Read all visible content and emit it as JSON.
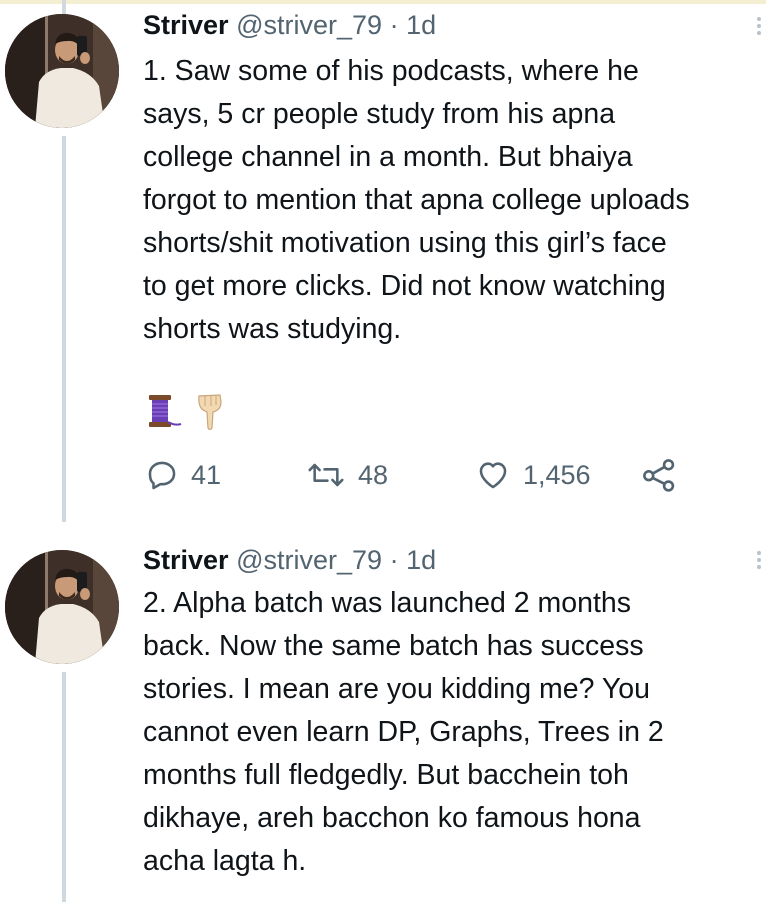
{
  "tweets": [
    {
      "author": "Striver",
      "handle": "@striver_79",
      "separator": "·",
      "time": "1d",
      "lines": [
        "1. Saw some of his podcasts, where he",
        "says, 5 cr people study from his apna",
        "college channel in a month. But bhaiya",
        "forgot to mention that apna college uploads",
        "shorts/shit motivation using this girl’s face",
        "to get more clicks. Did not know watching",
        "shorts was studying."
      ],
      "emojis": [
        "spool-of-thread",
        "backhand-index-pointing-down"
      ],
      "actions": {
        "replies": "41",
        "retweets": "48",
        "likes": "1,456"
      }
    },
    {
      "author": "Striver",
      "handle": "@striver_79",
      "separator": "·",
      "time": "1d",
      "lines": [
        "2. Alpha batch was launched 2 months",
        "back. Now the same batch has success",
        "stories. I mean are you kidding me? You",
        "cannot even learn DP, Graphs, Trees in 2",
        "months full fledgedly. But bacchein toh",
        "dikhaye, areh bacchon ko famous hona",
        "acha lagta h."
      ]
    }
  ],
  "colors": {
    "text": "#0f1419",
    "secondary": "#536471",
    "thread_line": "#cfd9de"
  }
}
